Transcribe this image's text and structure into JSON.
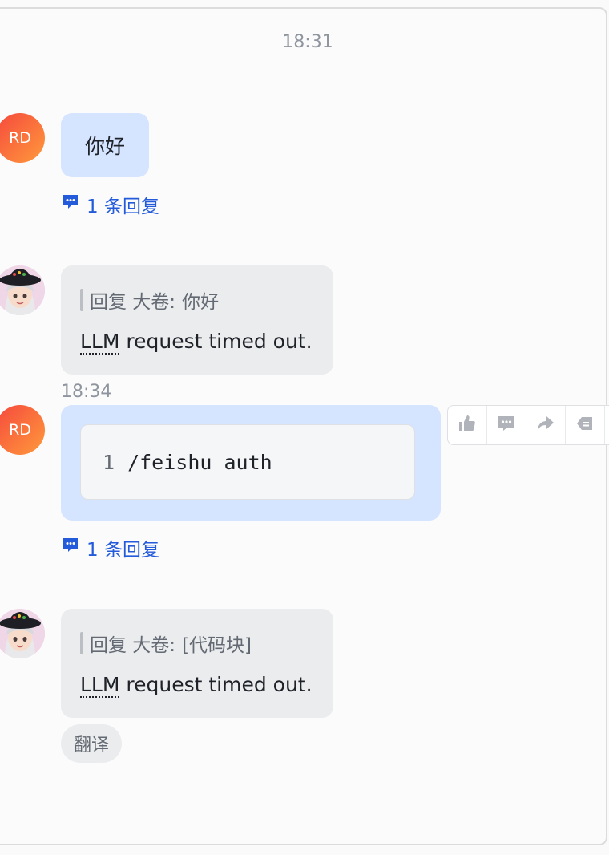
{
  "top_timestamp": "18:31",
  "messages": [
    {
      "avatar": "RD",
      "text": "你好",
      "reply_count": "1 条回复"
    },
    {
      "quote_prefix": "回复 大卷:",
      "quote_target": "你好",
      "text_abbr": "LLM",
      "text_rest": " request timed out."
    },
    {
      "time": "18:34",
      "avatar": "RD",
      "code_line_no": "1",
      "code_text": "/feishu auth",
      "reply_count": "1 条回复"
    },
    {
      "quote_prefix": "回复 大卷:",
      "quote_target": "[代码块]",
      "text_abbr": "LLM",
      "text_rest": " request timed out.",
      "translate": "翻译"
    }
  ],
  "toolbar": {
    "icons": [
      "thumbs-up-icon",
      "comment-icon",
      "forward-icon",
      "tag-icon"
    ]
  },
  "colors": {
    "user_bubble": "#d5e4ff",
    "bot_bubble": "#ebecee",
    "link": "#245bdb",
    "avatar_gradient_start": "#f5483d",
    "avatar_gradient_end": "#ff9a3c"
  }
}
